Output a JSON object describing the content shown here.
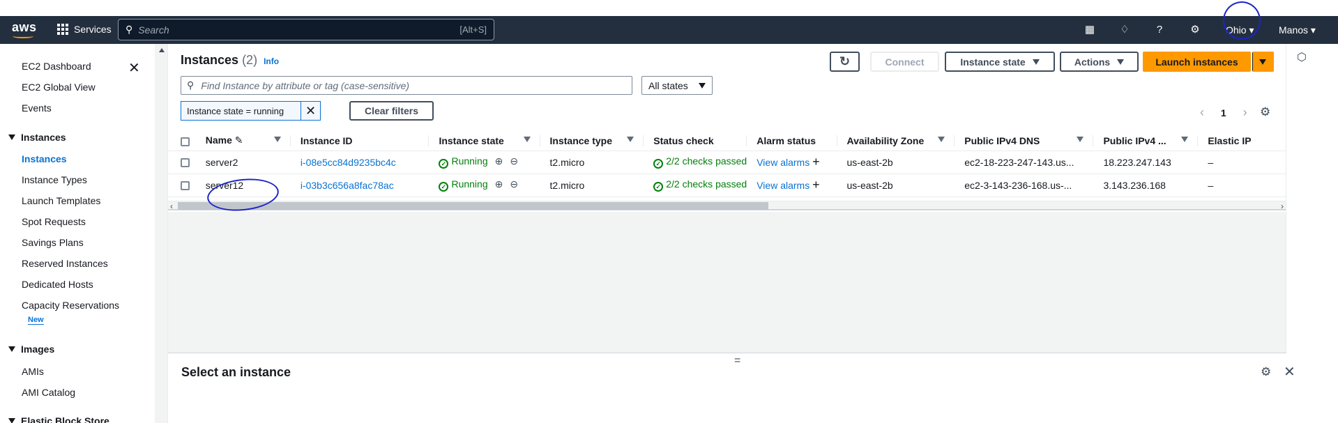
{
  "nav": {
    "logo": "aws",
    "services": "Services",
    "search_placeholder": "Search",
    "search_shortcut": "[Alt+S]",
    "region": "Ohio",
    "user": "Manos"
  },
  "sidebar": {
    "items": [
      {
        "label": "EC2 Dashboard"
      },
      {
        "label": "EC2 Global View"
      },
      {
        "label": "Events"
      }
    ],
    "sections": [
      {
        "label": "Instances",
        "items": [
          "Instances",
          "Instance Types",
          "Launch Templates",
          "Spot Requests",
          "Savings Plans",
          "Reserved Instances",
          "Dedicated Hosts",
          "Capacity Reservations"
        ]
      },
      {
        "label": "Images",
        "items": [
          "AMIs",
          "AMI Catalog"
        ]
      },
      {
        "label": "Elastic Block Store"
      }
    ],
    "new_badge": "New"
  },
  "header": {
    "title": "Instances",
    "count": "(2)",
    "info": "Info"
  },
  "toolbar": {
    "connect": "Connect",
    "instance_state": "Instance state",
    "actions": "Actions",
    "launch": "Launch instances"
  },
  "filter": {
    "placeholder": "Find Instance by attribute or tag (case-sensitive)",
    "states": "All states",
    "token": "Instance state = running",
    "clear": "Clear filters"
  },
  "pager": {
    "page": "1"
  },
  "table": {
    "columns": [
      "Name",
      "Instance ID",
      "Instance state",
      "Instance type",
      "Status check",
      "Alarm status",
      "Availability Zone",
      "Public IPv4 DNS",
      "Public IPv4 ...",
      "Elastic IP"
    ],
    "rows": [
      {
        "name": "server2",
        "id": "i-08e5cc84d9235bc4c",
        "state": "Running",
        "type": "t2.micro",
        "status": "2/2 checks passed",
        "alarm": "View alarms",
        "az": "us-east-2b",
        "dns": "ec2-18-223-247-143.us...",
        "ip": "18.223.247.143",
        "eip": "–"
      },
      {
        "name": "server12",
        "id": "i-03b3c656a8fac78ac",
        "state": "Running",
        "type": "t2.micro",
        "status": "2/2 checks passed",
        "alarm": "View alarms",
        "az": "us-east-2b",
        "dns": "ec2-3-143-236-168.us-...",
        "ip": "3.143.236.168",
        "eip": "–"
      }
    ]
  },
  "details": {
    "title": "Select an instance"
  }
}
